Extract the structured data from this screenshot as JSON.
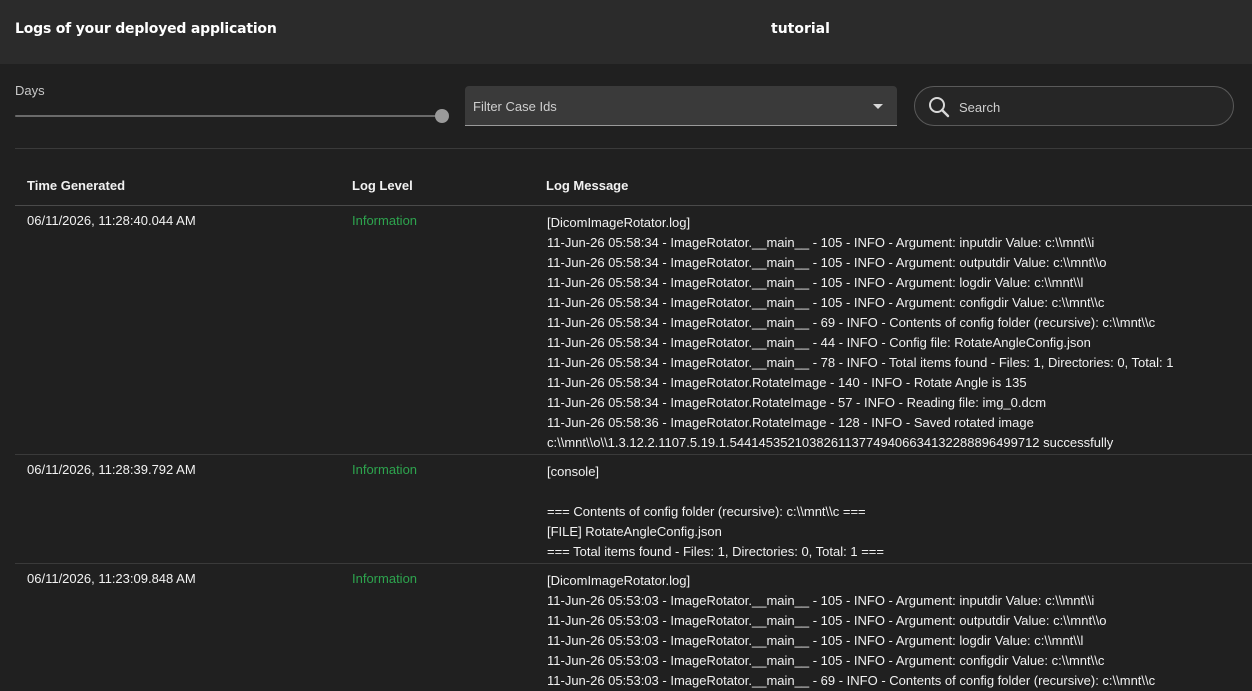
{
  "header": {
    "title": "Logs of your deployed application",
    "app_name": "tutorial"
  },
  "controls": {
    "days_label": "Days",
    "days_slider_fraction": 1.0,
    "filter_placeholder": "Filter Case Ids",
    "search_placeholder": "Search"
  },
  "table": {
    "columns": [
      "Time Generated",
      "Log Level",
      "Log Message"
    ],
    "rows": [
      {
        "time": "06/11/2026, 11:28:40.044 AM",
        "level": "Information",
        "lines": [
          "[DicomImageRotator.log]",
          "11-Jun-26 05:58:34 - ImageRotator.__main__ - 105 - INFO - Argument: inputdir Value: c:\\\\mnt\\\\i",
          "11-Jun-26 05:58:34 - ImageRotator.__main__ - 105 - INFO - Argument: outputdir Value: c:\\\\mnt\\\\o",
          "11-Jun-26 05:58:34 - ImageRotator.__main__ - 105 - INFO - Argument: logdir Value: c:\\\\mnt\\\\l",
          "11-Jun-26 05:58:34 - ImageRotator.__main__ - 105 - INFO - Argument: configdir Value: c:\\\\mnt\\\\c",
          "11-Jun-26 05:58:34 - ImageRotator.__main__ - 69 - INFO - Contents of config folder (recursive): c:\\\\mnt\\\\c",
          "11-Jun-26 05:58:34 - ImageRotator.__main__ - 44 - INFO - Config file: RotateAngleConfig.json",
          "11-Jun-26 05:58:34 - ImageRotator.__main__ - 78 - INFO - Total items found - Files: 1, Directories: 0, Total: 1",
          "11-Jun-26 05:58:34 - ImageRotator.RotateImage - 140 - INFO - Rotate Angle is 135",
          "11-Jun-26 05:58:34 - ImageRotator.RotateImage - 57 - INFO - Reading file: img_0.dcm",
          "11-Jun-26 05:58:36 - ImageRotator.RotateImage - 128 - INFO - Saved rotated image",
          "c:\\\\mnt\\\\o\\\\1.3.12.2.1107.5.19.1.5441453521038261137749406634132288896499712 successfully"
        ]
      },
      {
        "time": "06/11/2026, 11:28:39.792 AM",
        "level": "Information",
        "lines": [
          "[console]",
          "",
          "=== Contents of config folder (recursive): c:\\\\mnt\\\\c ===",
          "[FILE] RotateAngleConfig.json",
          "=== Total items found - Files: 1, Directories: 0, Total: 1 ==="
        ]
      },
      {
        "time": "06/11/2026, 11:23:09.848 AM",
        "level": "Information",
        "lines": [
          "[DicomImageRotator.log]",
          "11-Jun-26 05:53:03 - ImageRotator.__main__ - 105 - INFO - Argument: inputdir Value: c:\\\\mnt\\\\i",
          "11-Jun-26 05:53:03 - ImageRotator.__main__ - 105 - INFO - Argument: outputdir Value: c:\\\\mnt\\\\o",
          "11-Jun-26 05:53:03 - ImageRotator.__main__ - 105 - INFO - Argument: logdir Value: c:\\\\mnt\\\\l",
          "11-Jun-26 05:53:03 - ImageRotator.__main__ - 105 - INFO - Argument: configdir Value: c:\\\\mnt\\\\c",
          "11-Jun-26 05:53:03 - ImageRotator.__main__ - 69 - INFO - Contents of config folder (recursive): c:\\\\mnt\\\\c"
        ]
      }
    ]
  },
  "colors": {
    "info_level": "#2da44e",
    "header_bg": "#2b2b2b",
    "page_bg": "#202020"
  },
  "icons": {
    "search": "search-icon",
    "dropdown": "chevron-down-icon"
  }
}
